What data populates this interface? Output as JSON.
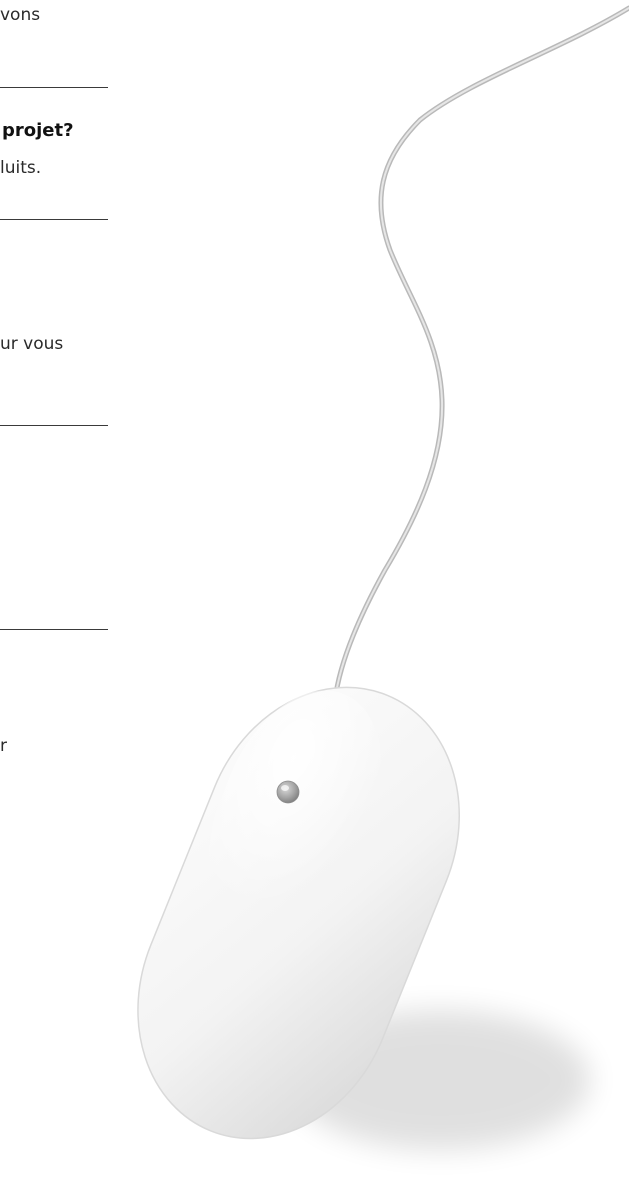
{
  "fragments": {
    "top_line": "vons",
    "question": "projet?",
    "products": "luits.",
    "offer": "ur vous",
    "lower": "r"
  },
  "colors": {
    "rule": "#3a3a3a",
    "mouse_body": "#f4f4f4",
    "mouse_button": "#9a9a9a",
    "cable": "#c4c4c4"
  },
  "icons": {
    "illustration": "computer-mouse-with-cable"
  }
}
